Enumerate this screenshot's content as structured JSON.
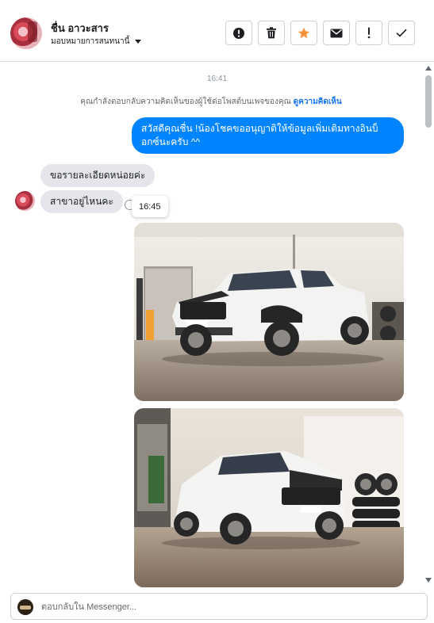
{
  "header": {
    "user_name": "ชื่น อาวะสาร",
    "assign_label": "มอบหมายการสนทนานี้",
    "actions": [
      {
        "name": "report-spam-button",
        "icon": "alert-circle-icon"
      },
      {
        "name": "delete-button",
        "icon": "trash-icon"
      },
      {
        "name": "star-button",
        "icon": "star-icon"
      },
      {
        "name": "mark-unread-button",
        "icon": "envelope-icon"
      },
      {
        "name": "follow-up-button",
        "icon": "exclamation-icon"
      },
      {
        "name": "mark-done-button",
        "icon": "checkmark-icon"
      }
    ],
    "star_color": "#f7923b"
  },
  "thread": {
    "timestamp_top": "16:41",
    "notice_text": "คุณกำลังตอบกลับความคิดเห็นของผู้ใช้ต่อโพสต์บนเพจของคุณ",
    "notice_link": "ดูความคิดเห็น",
    "outgoing_message": "สวัสดีคุณชื่น !น้องโชคขออนุญาติให้ข้อมูลเพิ่มเติมทางอินบ็อกซ์นะครับ ^^",
    "incoming_messages": [
      "ขอรายละเอียดหน่อยค่ะ",
      "สาขาอยู่ไหนคะ"
    ],
    "hover_timestamp": "16:45",
    "photos": [
      {
        "subject": "white pickup truck with black front grille in garage",
        "plate": "ผง 2614"
      },
      {
        "subject": "white pickup truck with black hood stripe in garage",
        "plate": "ผง 2614"
      }
    ]
  },
  "composer": {
    "placeholder": "ตอบกลับใน Messenger..."
  },
  "colors": {
    "outgoing_bubble": "#0084ff",
    "incoming_bubble": "#e4e6eb",
    "link": "#1876f2"
  }
}
